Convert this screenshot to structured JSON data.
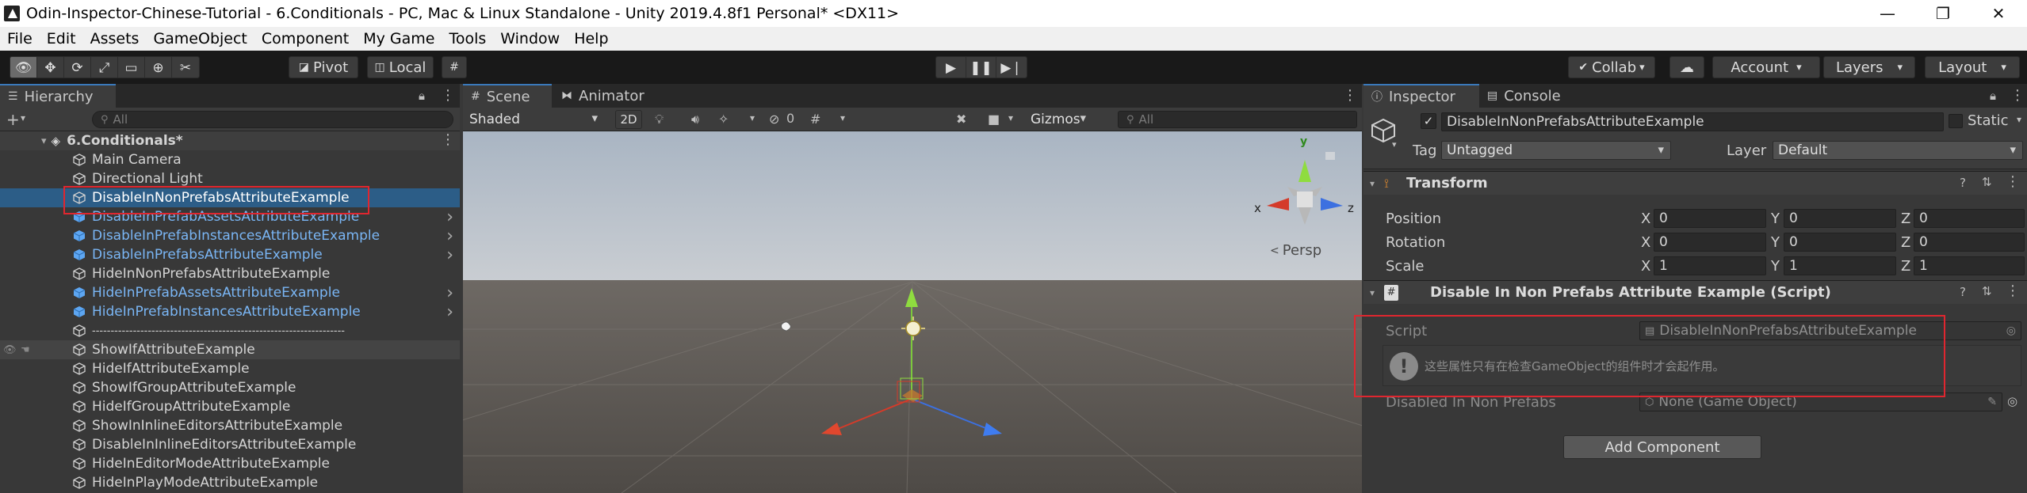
{
  "window": {
    "title": "Odin-Inspector-Chinese-Tutorial - 6.Conditionals - PC, Mac & Linux Standalone - Unity 2019.4.8f1 Personal* <DX11>",
    "minimize": "—",
    "maximize": "❐",
    "close": "✕"
  },
  "menu": [
    "File",
    "Edit",
    "Assets",
    "GameObject",
    "Component",
    "My Game",
    "Tools",
    "Window",
    "Help"
  ],
  "toolbar": {
    "pivot_label": "Pivot",
    "local_label": "Local",
    "collab_label": "Collab",
    "account_label": "Account",
    "layers_label": "Layers",
    "layout_label": "Layout"
  },
  "hierarchy": {
    "tab_label": "Hierarchy",
    "search_placeholder": "All",
    "scene_name": "6.Conditionals*",
    "items": [
      {
        "label": "Main Camera",
        "style": "normal"
      },
      {
        "label": "Directional Light",
        "style": "normal"
      },
      {
        "label": "DisableInNonPrefabsAttributeExample",
        "style": "selected"
      },
      {
        "label": "DisableInPrefabAssetsAttributeExample",
        "style": "blue"
      },
      {
        "label": "DisableInPrefabInstancesAttributeExample",
        "style": "blue"
      },
      {
        "label": "DisableInPrefabsAttributeExample",
        "style": "blue"
      },
      {
        "label": "HideInNonPrefabsAttributeExample",
        "style": "normal"
      },
      {
        "label": "HideInPrefabAssetsAttributeExample",
        "style": "blue"
      },
      {
        "label": "HideInPrefabInstancesAttributeExample",
        "style": "blue"
      },
      {
        "label": "--------------------------------------------------------------------",
        "style": "normal"
      },
      {
        "label": "ShowIfAttributeExample",
        "style": "hover"
      },
      {
        "label": "HideIfAttributeExample",
        "style": "normal"
      },
      {
        "label": "ShowIfGroupAttributeExample",
        "style": "normal"
      },
      {
        "label": "HideIfGroupAttributeExample",
        "style": "normal"
      },
      {
        "label": "ShowInInlineEditorsAttributeExample",
        "style": "normal"
      },
      {
        "label": "DisableInInlineEditorsAttributeExample",
        "style": "normal"
      },
      {
        "label": "HideInEditorModeAttributeExample",
        "style": "normal"
      },
      {
        "label": "HideInPlayModeAttributeExample",
        "style": "normal"
      }
    ]
  },
  "scene": {
    "tab_scene": "Scene",
    "tab_animator": "Animator",
    "shading_mode": "Shaded",
    "mode_2d": "2D",
    "fx_count": "0",
    "gizmos_label": "Gizmos",
    "search_placeholder": "All",
    "persp_label": "Persp",
    "axis_y": "y",
    "axis_x": "x",
    "axis_z": "z"
  },
  "inspector": {
    "tab_inspector": "Inspector",
    "tab_console": "Console",
    "object_name": "DisableInNonPrefabsAttributeExample",
    "static_label": "Static",
    "tag_label": "Tag",
    "tag_value": "Untagged",
    "layer_label": "Layer",
    "layer_value": "Default",
    "transform": {
      "title": "Transform",
      "position_label": "Position",
      "rotation_label": "Rotation",
      "scale_label": "Scale",
      "position": {
        "x": "0",
        "y": "0",
        "z": "0"
      },
      "rotation": {
        "x": "0",
        "y": "0",
        "z": "0"
      },
      "scale": {
        "x": "1",
        "y": "1",
        "z": "1"
      },
      "axis_x": "X",
      "axis_y": "Y",
      "axis_z": "Z"
    },
    "script_component": {
      "title": "Disable In Non Prefabs Attribute Example (Script)",
      "script_label": "Script",
      "script_value": "DisableInNonPrefabsAttributeExample",
      "info_text": "这些属性只有在检查GameObject的组件时才会起作用。",
      "field_label": "Disabled In Non Prefabs",
      "field_value": "None (Game Object)"
    },
    "add_component_label": "Add Component"
  },
  "colors": {
    "accent_selection": "#2c5d87",
    "highlight_box": "#e0262f",
    "prefab_blue": "#7ab6f5"
  }
}
